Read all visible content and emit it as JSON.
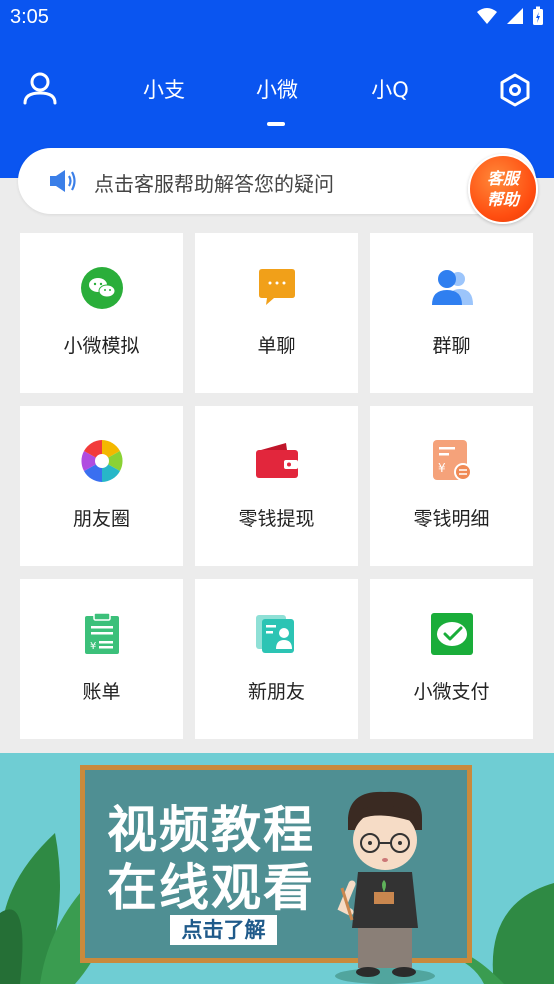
{
  "status_bar": {
    "time": "3:05"
  },
  "tabs": [
    {
      "label": "小支"
    },
    {
      "label": "小微"
    },
    {
      "label": "小Q"
    }
  ],
  "active_tab": "小微",
  "notice": {
    "text": "点击客服帮助解答您的疑问",
    "badge_line1": "客服",
    "badge_line2": "帮助"
  },
  "features": [
    {
      "label": "小微模拟",
      "icon": "wechat-icon"
    },
    {
      "label": "单聊",
      "icon": "chat-bubble-icon"
    },
    {
      "label": "群聊",
      "icon": "group-icon"
    },
    {
      "label": "朋友圈",
      "icon": "moments-aperture-icon"
    },
    {
      "label": "零钱提现",
      "icon": "wallet-icon"
    },
    {
      "label": "零钱明细",
      "icon": "change-detail-icon"
    },
    {
      "label": "账单",
      "icon": "bill-icon"
    },
    {
      "label": "新朋友",
      "icon": "new-friend-icon"
    },
    {
      "label": "小微支付",
      "icon": "pay-icon"
    }
  ],
  "banner": {
    "line1": "视频教程",
    "line2": "在线观看",
    "button": "点击了解",
    "page_count": 2,
    "active_page": 2
  },
  "colors": {
    "header": "#0a55f0",
    "accent_orange": "#ff5a1a",
    "wechat_green": "#2aae3a"
  }
}
